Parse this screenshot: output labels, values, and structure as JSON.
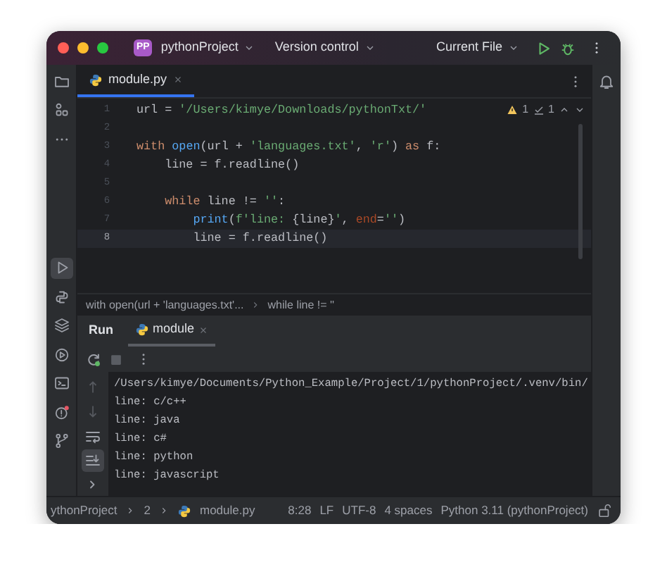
{
  "title_bar": {
    "project_badge": "PP",
    "project": "pythonProject",
    "vcs": "Version control",
    "run_config": "Current File"
  },
  "left_tools_top": [
    {
      "kind": "folder",
      "selected": false
    },
    {
      "kind": "structure",
      "selected": false
    },
    {
      "kind": "more",
      "selected": false
    }
  ],
  "left_tools_bottom": [
    {
      "kind": "run",
      "selected": true
    },
    {
      "kind": "python",
      "selected": false
    },
    {
      "kind": "layers",
      "selected": false
    },
    {
      "kind": "services",
      "selected": false
    },
    {
      "kind": "terminal",
      "selected": false
    },
    {
      "kind": "problems",
      "selected": false
    },
    {
      "kind": "git",
      "selected": false
    }
  ],
  "editor_tabs": [
    {
      "label": "module.py",
      "selected": true
    }
  ],
  "inspections": {
    "warnings": "1",
    "weak_warnings": "1"
  },
  "code_lines": [
    {
      "number": "1",
      "current": false,
      "tokens": [
        {
          "kind": "plain",
          "text": "url = "
        },
        {
          "kind": "str",
          "text": "'/Users/kimye/Downloads/pythonTxt/'"
        }
      ]
    },
    {
      "number": "2",
      "current": false
    },
    {
      "number": "3",
      "current": false,
      "tokens": [
        {
          "kind": "kw",
          "text": "with "
        },
        {
          "kind": "fn",
          "text": "open"
        },
        {
          "kind": "plain",
          "text": "(url + "
        },
        {
          "kind": "str",
          "text": "'languages.txt'"
        },
        {
          "kind": "plain",
          "text": ", "
        },
        {
          "kind": "str",
          "text": "'r'"
        },
        {
          "kind": "plain",
          "text": ") "
        },
        {
          "kind": "kw",
          "text": "as"
        },
        {
          "kind": "plain",
          "text": " f:"
        }
      ]
    },
    {
      "number": "4",
      "current": false,
      "tokens": [
        {
          "kind": "plain",
          "text": "    line = f.readline()"
        }
      ]
    },
    {
      "number": "5",
      "current": false
    },
    {
      "number": "6",
      "current": false,
      "tokens": [
        {
          "kind": "kw",
          "text": "    while"
        },
        {
          "kind": "plain",
          "text": " line != "
        },
        {
          "kind": "str",
          "text": "''"
        },
        {
          "kind": "plain",
          "text": ":"
        }
      ]
    },
    {
      "number": "7",
      "current": false,
      "tokens": [
        {
          "kind": "fn",
          "text": "        print"
        },
        {
          "kind": "plain",
          "text": "("
        },
        {
          "kind": "str",
          "text": "f'line: "
        },
        {
          "kind": "plain",
          "text": "{line}"
        },
        {
          "kind": "str",
          "text": "'"
        },
        {
          "kind": "plain",
          "text": ", "
        },
        {
          "kind": "param",
          "text": "end"
        },
        {
          "kind": "plain",
          "text": "="
        },
        {
          "kind": "str",
          "text": "''"
        },
        {
          "kind": "plain",
          "text": ")"
        }
      ]
    },
    {
      "number": "8",
      "current": true,
      "tokens": [
        {
          "kind": "plain",
          "text": "        line = f.readline()"
        }
      ]
    }
  ],
  "breadcrumbs": [
    "with open(url + 'languages.txt'...",
    "while line != ''"
  ],
  "run_panel": {
    "title": "Run",
    "tabs": [
      {
        "label": "module",
        "selected": true
      }
    ],
    "gutter_tools": [
      {
        "kind": "up",
        "selected": false
      },
      {
        "kind": "down",
        "selected": false
      },
      {
        "kind": "wrap",
        "selected": false
      },
      {
        "kind": "scroll-end",
        "selected": true
      },
      {
        "kind": "expand",
        "selected": false
      }
    ],
    "output": [
      "/Users/kimye/Documents/Python_Example/Project/1/pythonProject/.venv/bin/",
      "line: c/c++",
      "line: java",
      "line: c#",
      "line: python",
      "line: javascript"
    ]
  },
  "status_bar": {
    "path": [
      "ythonProject",
      "2",
      "module.py"
    ],
    "items": [
      "8:28",
      "LF",
      "UTF-8",
      "4 spaces",
      "Python 3.11 (pythonProject)"
    ]
  }
}
